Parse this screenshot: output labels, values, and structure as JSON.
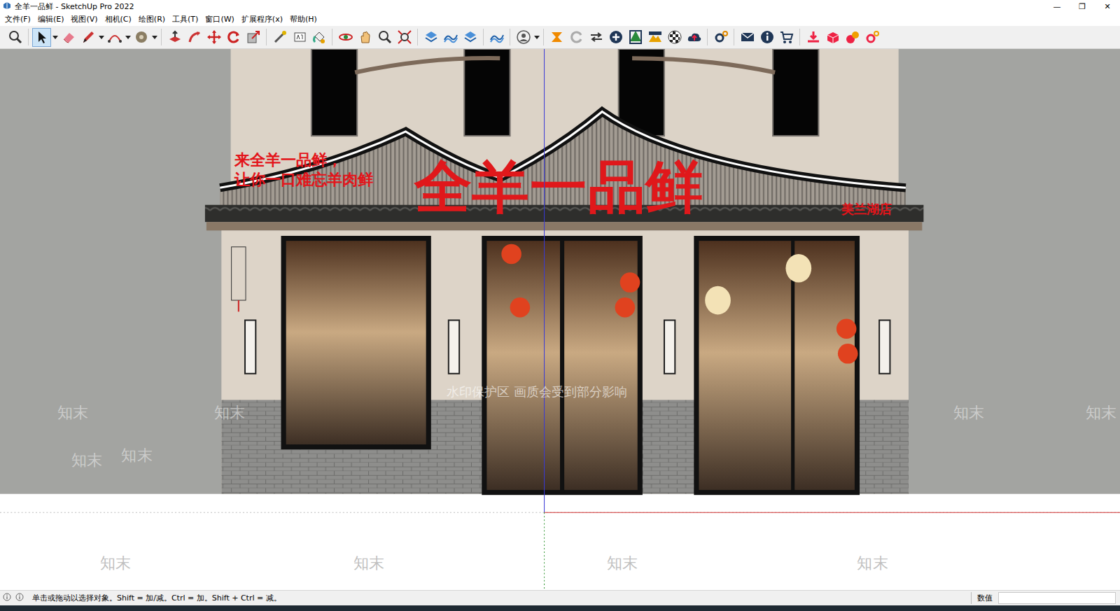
{
  "window": {
    "title": "全羊一品鲜 - SketchUp Pro 2022",
    "controls": [
      "—",
      "❐",
      "✕"
    ]
  },
  "menu": [
    {
      "label": "文件(F)"
    },
    {
      "label": "编辑(E)"
    },
    {
      "label": "视图(V)"
    },
    {
      "label": "相机(C)"
    },
    {
      "label": "绘图(R)"
    },
    {
      "label": "工具(T)"
    },
    {
      "label": "窗口(W)"
    },
    {
      "label": "扩展程序(x)"
    },
    {
      "label": "帮助(H)"
    }
  ],
  "toolbar": {
    "tools": [
      {
        "selected": false
      },
      {
        "selected": true
      },
      {
        "selected": false
      },
      {
        "selected": false
      },
      {
        "selected": false
      },
      {
        "selected": false
      },
      {
        "selected": false
      },
      {
        "selected": false
      },
      {
        "selected": false
      },
      {
        "selected": false
      },
      {
        "selected": false
      },
      {
        "selected": false
      },
      {
        "selected": false
      },
      {
        "selected": false
      },
      {
        "selected": false
      },
      {
        "selected": false
      },
      {
        "selected": false
      },
      {
        "selected": false
      },
      {
        "selected": false
      },
      {
        "selected": false
      },
      {
        "selected": false
      },
      {
        "selected": false
      },
      {
        "selected": false
      },
      {
        "selected": false
      },
      {
        "selected": false
      },
      {
        "selected": false
      },
      {
        "selected": false
      },
      {
        "selected": false
      },
      {
        "selected": false
      },
      {
        "selected": false
      },
      {
        "selected": false
      },
      {
        "selected": false
      },
      {
        "selected": false
      },
      {
        "selected": false
      },
      {
        "selected": false
      },
      {
        "selected": false
      },
      {
        "selected": false
      },
      {
        "selected": false
      }
    ]
  },
  "viewport": {
    "sign": {
      "slogan": [
        "来全羊一品鲜，",
        "让你一口难忘羊肉鲜"
      ],
      "name": "全羊一品鲜",
      "branch": "美兰湖店"
    },
    "watermark": {
      "notice": "水印保护区 画质会受到部分影响",
      "marks": [
        "知末",
        "知末",
        "知末",
        "知末",
        "知末",
        "知末",
        "知末",
        "知末",
        "知末",
        "知末"
      ]
    }
  },
  "status_bar": {
    "hint": "单击或拖动以选择对象。Shift = 加/减。Ctrl = 加。Shift + Ctrl = 减。",
    "measurement_label": "数值",
    "measurement_value": ""
  }
}
